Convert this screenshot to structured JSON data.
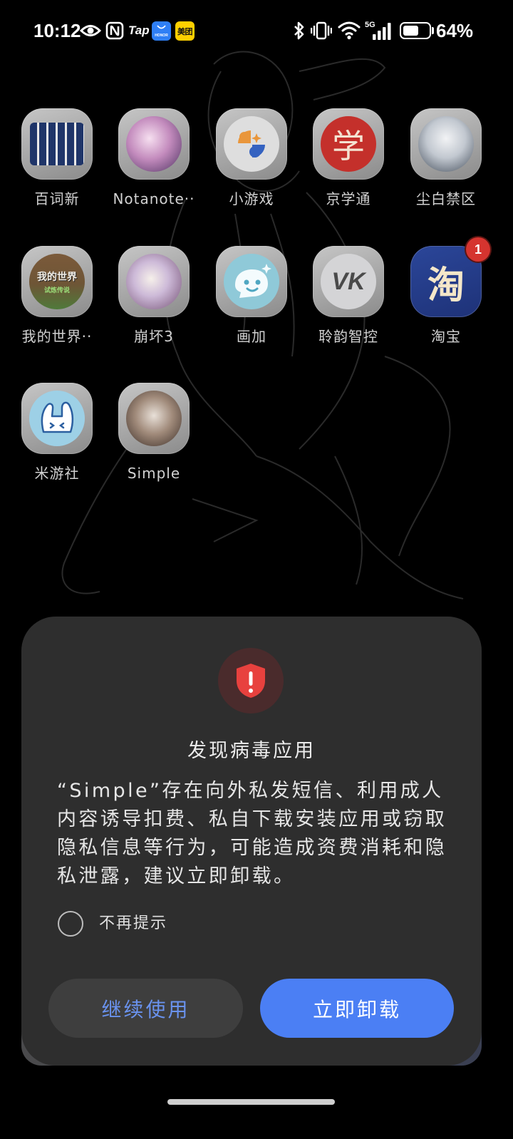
{
  "status_bar": {
    "time": "10:12",
    "tap_label": "Tap",
    "honor_icon_text": "HONOR",
    "meituan_label": "美团",
    "network_type": "5G",
    "battery_text": "64%",
    "battery_level": 0.64,
    "icons": [
      "eye-icon",
      "nfc-icon",
      "tap-icon",
      "honor-app-icon",
      "meituan-icon",
      "bluetooth-icon",
      "vibrate-icon",
      "wifi-icon",
      "signal-icon",
      "battery-icon"
    ]
  },
  "apps": [
    {
      "label": "百词新",
      "icon": "baicizhan-app-icon"
    },
    {
      "label": "Notanote··",
      "icon": "notanote-app-icon"
    },
    {
      "label": "小游戏",
      "icon": "mini-games-app-icon"
    },
    {
      "label": "京学通",
      "icon": "jingxuetong-app-icon",
      "glyph": "学"
    },
    {
      "label": "尘白禁区",
      "icon": "snowbreak-app-icon"
    },
    {
      "label": "我的世界··",
      "icon": "minecraft-app-icon",
      "logo_text": "我的世界",
      "logo_subtext": "试炼传说"
    },
    {
      "label": "崩坏3",
      "icon": "honkai3-app-icon"
    },
    {
      "label": "画加",
      "icon": "huajia-app-icon"
    },
    {
      "label": "聆韵智控",
      "icon": "lingyun-app-icon",
      "logo_text": "VK"
    },
    {
      "label": "淘宝",
      "icon": "taobao-app-icon",
      "glyph": "淘",
      "badge": "1"
    },
    {
      "label": "米游社",
      "icon": "miyoushe-app-icon"
    },
    {
      "label": "Simple",
      "icon": "simple-app-icon"
    }
  ],
  "dialog": {
    "icon": "shield-warning-icon",
    "title": "发现病毒应用",
    "message": "“Simple”存在向外私发短信、利用成人内容诱导扣费、私自下载安装应用或窃取隐私信息等行为，可能造成资费消耗和隐私泄露，建议立即卸载。",
    "dont_remind_label": "不再提示",
    "dont_remind_checked": false,
    "continue_label": "继续使用",
    "uninstall_label": "立即卸载"
  },
  "colors": {
    "accent": "#4b7ff4",
    "danger": "#e8413e",
    "badge": "#d5342f",
    "dialog_bg": "#2e2e2e"
  }
}
